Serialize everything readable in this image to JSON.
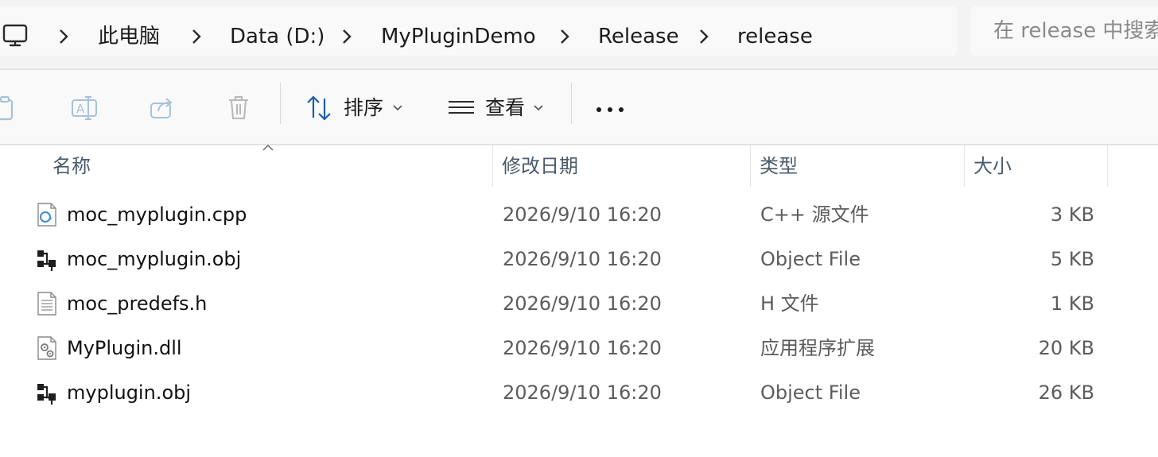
{
  "address_bar": {
    "pc_icon": "computer-icon",
    "breadcrumbs": [
      {
        "label": "此电脑"
      },
      {
        "label": "Data (D:)"
      },
      {
        "label": "MyPluginDemo"
      },
      {
        "label": "Release"
      },
      {
        "label": "release"
      }
    ],
    "separator_icon": "chevron-right-icon"
  },
  "search": {
    "placeholder": "在 release 中搜索"
  },
  "toolbar": {
    "copy_icon": "copy-icon",
    "rename_icon": "rename-icon",
    "share_icon": "share-icon",
    "delete_icon": "delete-icon",
    "sort_label": "排序",
    "view_label": "查看",
    "more_icon": "more-horizontal-icon"
  },
  "columns": {
    "name": "名称",
    "modified": "修改日期",
    "type": "类型",
    "size": "大小",
    "sorted_by": "name",
    "sort_direction": "ascending"
  },
  "files": [
    {
      "name": "moc_myplugin.cpp",
      "modified": "2026/9/10 16:20",
      "type": "C++ 源文件",
      "size": "3 KB",
      "icon": "cpp-file-icon"
    },
    {
      "name": "moc_myplugin.obj",
      "modified": "2026/9/10 16:20",
      "type": "Object File",
      "size": "5 KB",
      "icon": "object-file-icon"
    },
    {
      "name": "moc_predefs.h",
      "modified": "2026/9/10 16:20",
      "type": "H 文件",
      "size": "1 KB",
      "icon": "text-file-icon"
    },
    {
      "name": "MyPlugin.dll",
      "modified": "2026/9/10 16:20",
      "type": "应用程序扩展",
      "size": "20 KB",
      "icon": "dll-file-icon"
    },
    {
      "name": "myplugin.obj",
      "modified": "2026/9/10 16:20",
      "type": "Object File",
      "size": "26 KB",
      "icon": "object-file-icon"
    }
  ],
  "colors": {
    "accent": "#0067c0",
    "header_text": "#4a5a6a",
    "secondary_text": "#5c5c5c",
    "disabled_icon": "#a8c1d8"
  }
}
